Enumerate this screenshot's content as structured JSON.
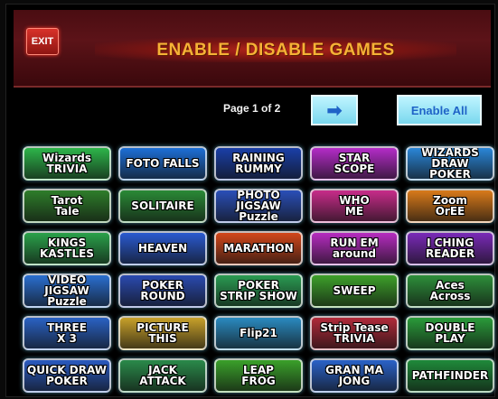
{
  "header": {
    "exit_label": "EXIT",
    "title": "ENABLE / DISABLE GAMES"
  },
  "pager": {
    "text": "Page 1 of 2",
    "next_arrow": "➡",
    "enable_all_label": "Enable All"
  },
  "games": [
    {
      "label": "Wizards\nTRIVIA",
      "color": "#2db54a"
    },
    {
      "label": "FOTO FALLS",
      "color": "#1d6fd6"
    },
    {
      "label": "RAINING\nRUMMY",
      "color": "#1a3fa8"
    },
    {
      "label": "STAR\nSCOPE",
      "color": "#b42cc8"
    },
    {
      "label": "WIZARDS DRAW\nPOKER",
      "color": "#2a86d8"
    },
    {
      "label": "Tarot\nTale",
      "color": "#2e7d2a"
    },
    {
      "label": "SOLITAIRE",
      "color": "#2a8a36"
    },
    {
      "label": "PHOTO JIGSAW\nPuzzle",
      "color": "#2a4fb8"
    },
    {
      "label": "WHO\nME",
      "color": "#c82c8a"
    },
    {
      "label": "Zoom\nOrEE",
      "color": "#d97a1a"
    },
    {
      "label": "KINGS\nKASTLES",
      "color": "#2aa14a"
    },
    {
      "label": "HEAVEN",
      "color": "#2a5ad0"
    },
    {
      "label": "MARATHON",
      "color": "#d2471a"
    },
    {
      "label": "RUN EM\naround",
      "color": "#b62cc0"
    },
    {
      "label": "I CHING\nREADER",
      "color": "#7a2ab8"
    },
    {
      "label": "VIDEO JIGSAW\nPuzzle",
      "color": "#2a6fd0"
    },
    {
      "label": "POKER\nROUND",
      "color": "#2a4ab0"
    },
    {
      "label": "POKER\nSTRIP SHOW",
      "color": "#2a9b52"
    },
    {
      "label": "SWEEP",
      "color": "#3da02a"
    },
    {
      "label": "Aces\nAcross",
      "color": "#2d8f3a"
    },
    {
      "label": "THREE\nX 3",
      "color": "#2a62c4"
    },
    {
      "label": "PICTURE\nTHIS",
      "color": "#c8a12a"
    },
    {
      "label": "Flip21",
      "color": "#2a8ac0"
    },
    {
      "label": "Strip Tease\nTRIVIA",
      "color": "#b02a3a"
    },
    {
      "label": "DOUBLE\nPLAY",
      "color": "#2a9b3a"
    },
    {
      "label": "QUICK DRAW\nPOKER",
      "color": "#2a5ac0"
    },
    {
      "label": "JACK\nATTACK",
      "color": "#2a8a4a"
    },
    {
      "label": "LEAP\nFROG",
      "color": "#3aa02a"
    },
    {
      "label": "GRAN MA\nJONG",
      "color": "#2a62c8"
    },
    {
      "label": "PATHFINDER",
      "color": "#1f8a3a"
    }
  ]
}
